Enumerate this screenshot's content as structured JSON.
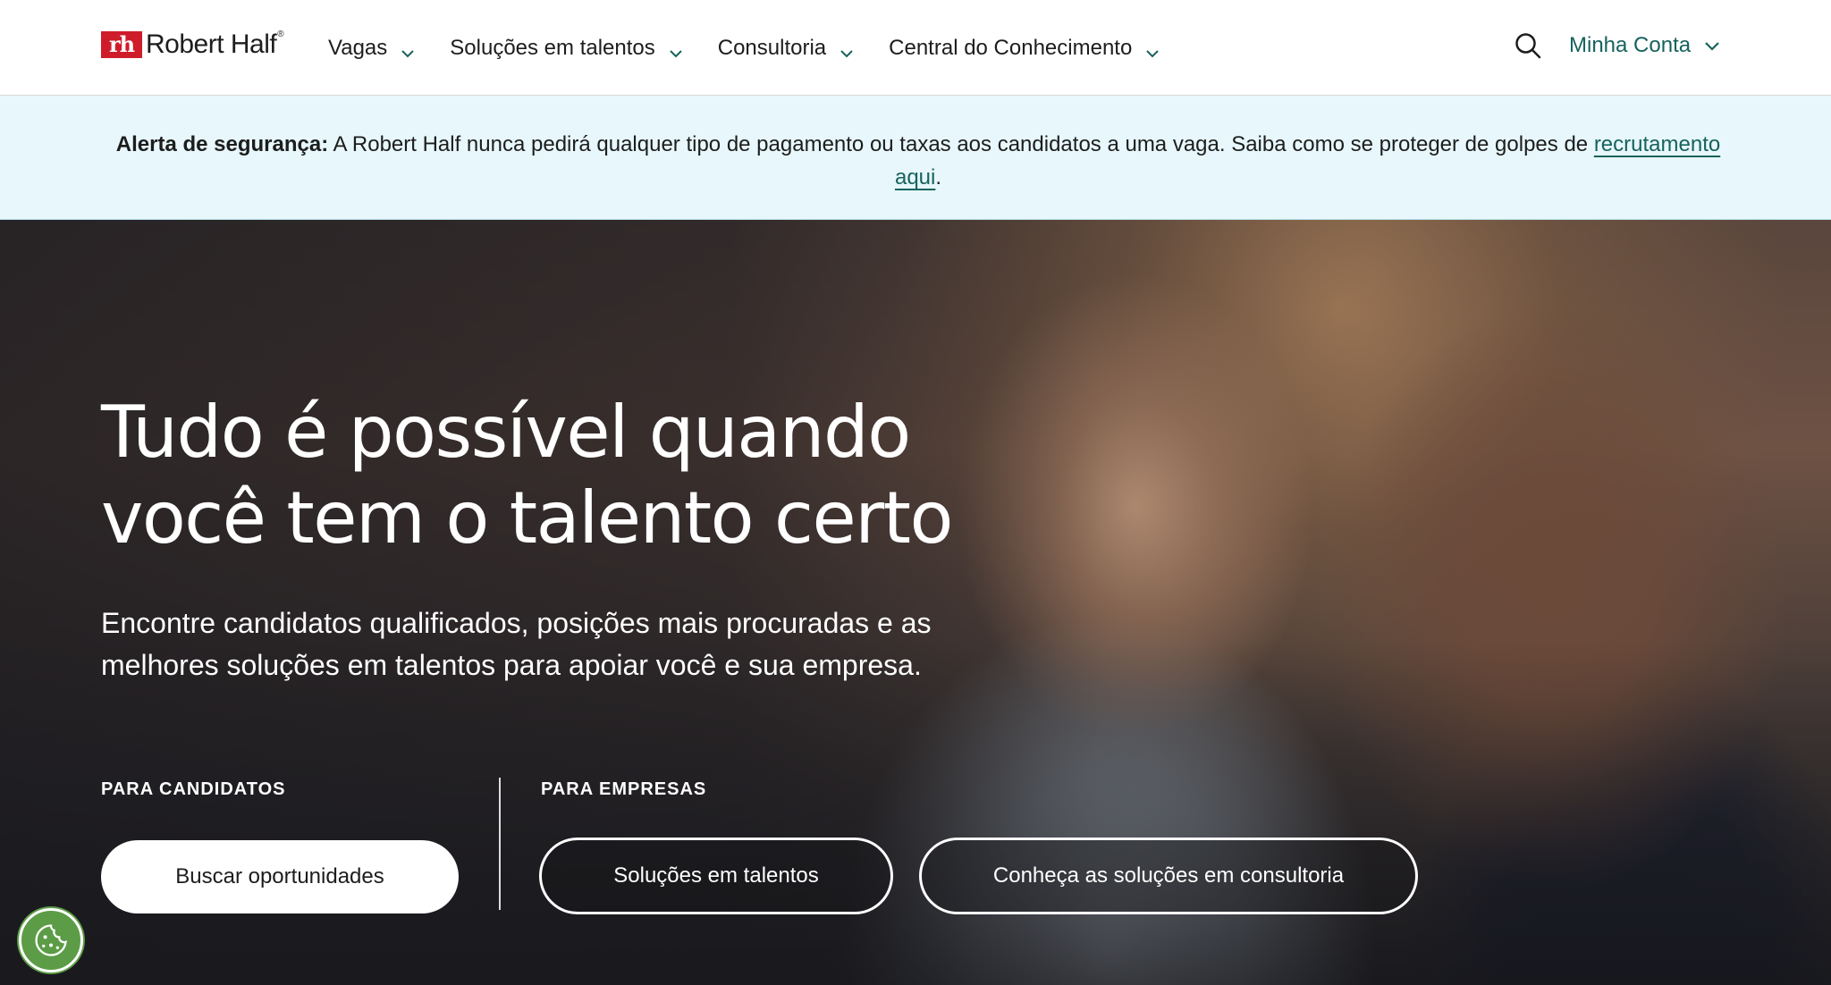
{
  "brand": {
    "mark": "rh",
    "name": "Robert Half",
    "reg": "®",
    "color": "#cf1c2b"
  },
  "nav": {
    "items": [
      {
        "label": "Vagas"
      },
      {
        "label": "Soluções em talentos"
      },
      {
        "label": "Consultoria"
      },
      {
        "label": "Central do Conhecimento"
      }
    ],
    "search_icon": "search-icon",
    "account_label": "Minha Conta",
    "account_color": "#17625e"
  },
  "alert": {
    "bold": "Alerta de segurança:",
    "text": " A Robert Half nunca pedirá qualquer tipo de pagamento ou taxas aos candidatos a uma vaga. Saiba como se proteger de golpes de ",
    "link": "recrutamento aqui",
    "end": ".",
    "background": "#e7f7fb"
  },
  "hero": {
    "title": "Tudo é possível quando você tem o talento certo",
    "subtitle": "Encontre candidatos qualificados, posições mais procuradas e as melhores soluções em talentos para apoiar você e sua empresa.",
    "candidates_label": "PARA CANDIDATOS",
    "companies_label": "PARA EMPRESAS",
    "btn_search": "Buscar oportunidades",
    "btn_talent": "Soluções em talentos",
    "btn_consulting": "Conheça as soluções em consultoria"
  },
  "cookie": {
    "icon": "cookie-icon",
    "color": "#5c9c46"
  }
}
